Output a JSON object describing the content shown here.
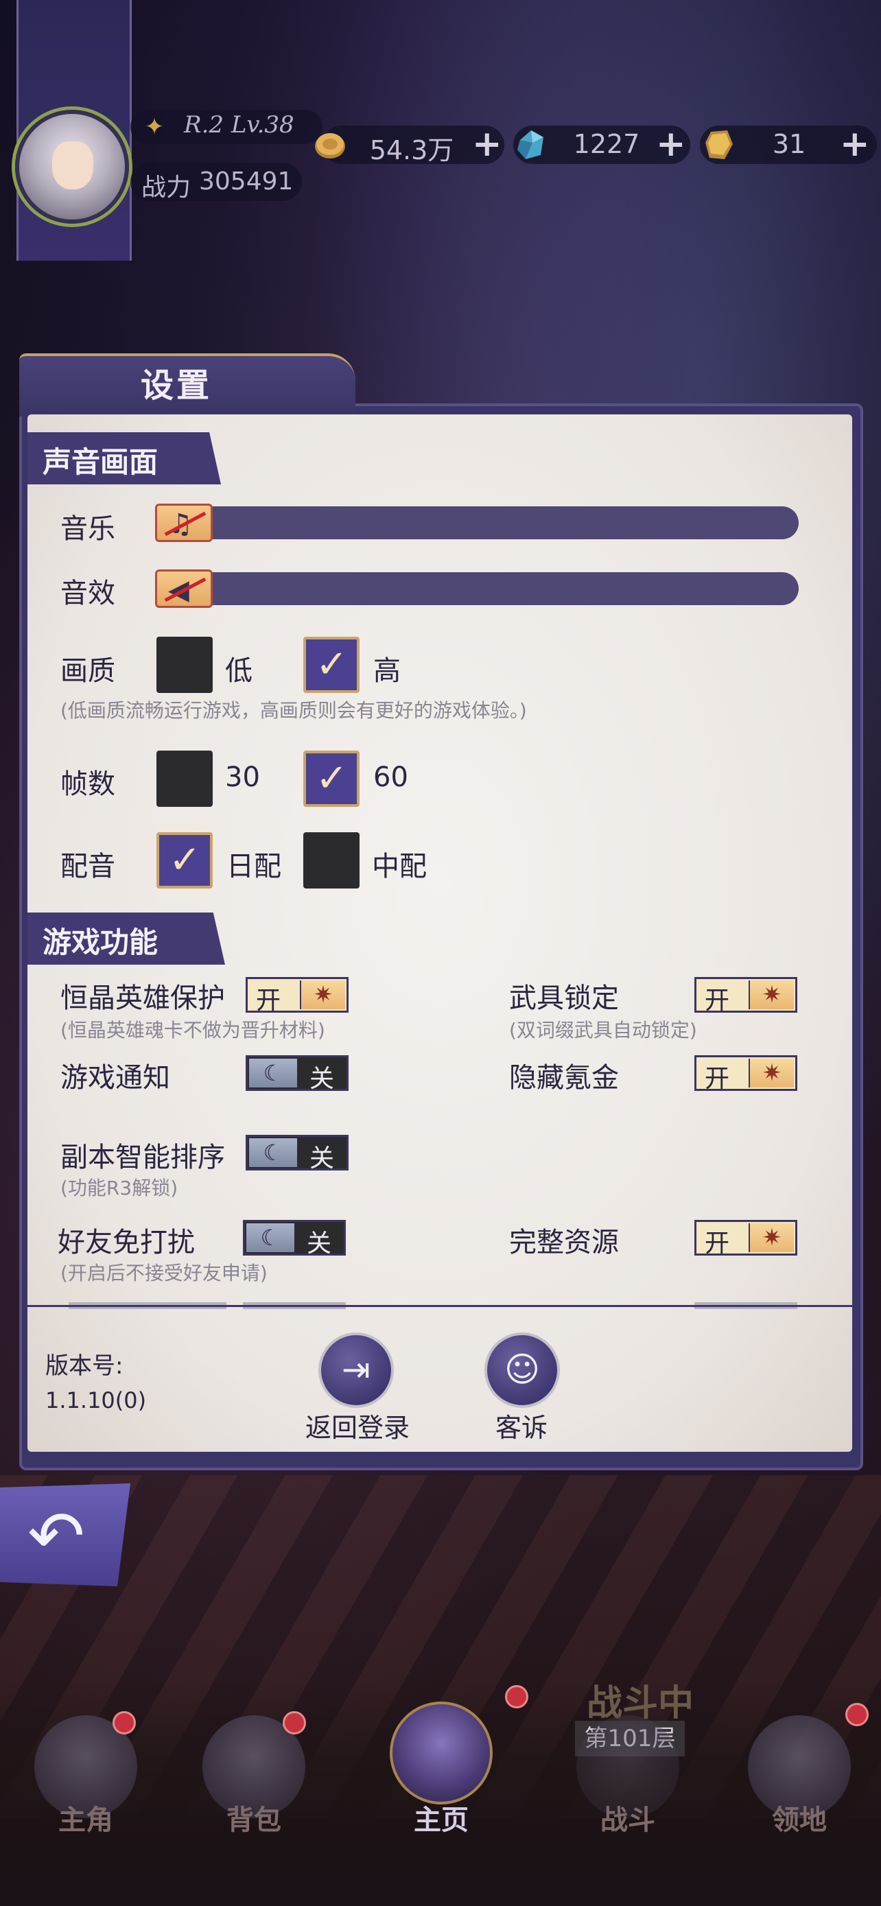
{
  "hud": {
    "rank": "R.2 Lv.38",
    "power_label": "战力",
    "power_value": "305491",
    "resources": [
      {
        "icon": "gold-coin-icon",
        "value": "54.3万"
      },
      {
        "icon": "blue-crystal-icon",
        "value": "1227"
      },
      {
        "icon": "gold-gem-icon",
        "value": "31"
      }
    ],
    "plus": "+"
  },
  "settings": {
    "title": "设置",
    "sound_section": {
      "header": "声音画面",
      "music_label": "音乐",
      "sfx_label": "音效",
      "music_level": 0,
      "sfx_level": 0
    },
    "quality": {
      "label": "画质",
      "low": "低",
      "high": "高",
      "selected": "高",
      "note": "(低画质流畅运行游戏，高画质则会有更好的游戏体验。)"
    },
    "fps": {
      "label": "帧数",
      "opt1": "30",
      "opt2": "60",
      "selected": "60"
    },
    "voice": {
      "label": "配音",
      "opt1": "日配",
      "opt2": "中配",
      "selected": "日配"
    },
    "game_section": {
      "header": "游戏功能",
      "on_text": "开",
      "off_text": "关",
      "items": {
        "hero_protect": {
          "label": "恒晶英雄保护",
          "note": "(恒晶英雄魂卡不做为晋升材料)",
          "state": "开"
        },
        "weapon_lock": {
          "label": "武具锁定",
          "note": "(双词缀武具自动锁定)",
          "state": "开"
        },
        "notify": {
          "label": "游戏通知",
          "state": "关"
        },
        "hide_pay": {
          "label": "隐藏氪金",
          "state": "开"
        },
        "auto_sort": {
          "label": "副本智能排序",
          "note": "(功能R3解锁)",
          "state": "关"
        },
        "friend_dnd": {
          "label": "好友免打扰",
          "note": "(开启后不接受好友申请)",
          "state": "关"
        },
        "full_res": {
          "label": "完整资源",
          "state": "开"
        }
      }
    },
    "footer": {
      "version_label": "版本号:",
      "version_value": "1.1.10(0)",
      "logout_label": "返回登录",
      "complain_label": "客诉"
    }
  },
  "nav": {
    "items": [
      {
        "label": "主角"
      },
      {
        "label": "背包"
      },
      {
        "label": "主页"
      },
      {
        "label": "战斗"
      },
      {
        "label": "领地"
      }
    ],
    "battle_status": "战斗中",
    "battle_floor": "第101层"
  },
  "colors": {
    "panel_purple": "#433a72",
    "paper": "#f0ece8",
    "accent_gold": "#c9a56a",
    "notification_red": "#c8323e"
  }
}
